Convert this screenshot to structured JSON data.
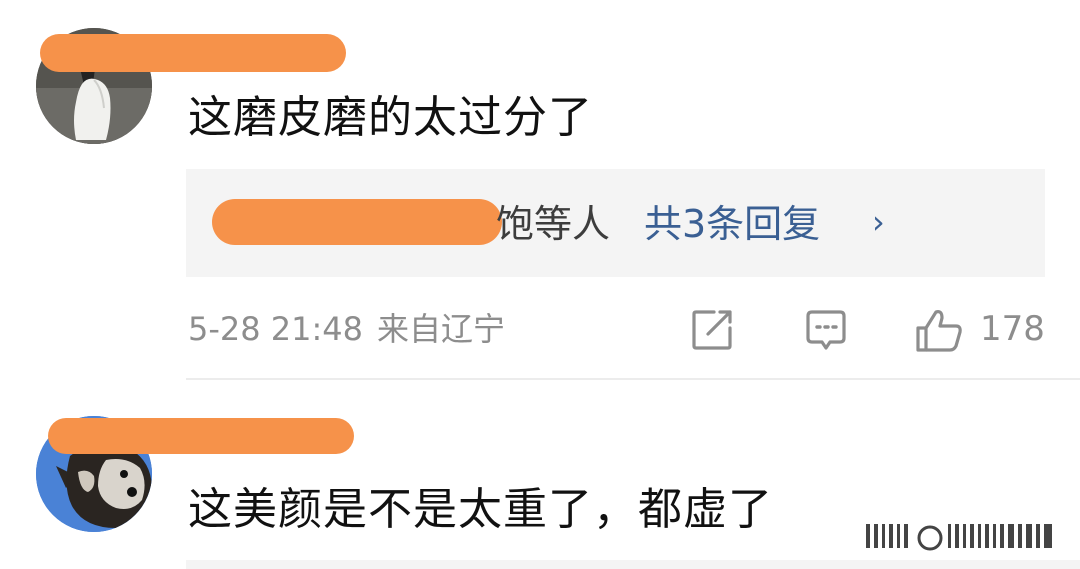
{
  "comments": [
    {
      "text": "这磨皮磨的太过分了",
      "replies": {
        "suffix": "饱等人",
        "count": "共3条回复",
        "chevron": "›"
      },
      "meta": {
        "date": "5-28 21:48",
        "location": "来自辽宁"
      },
      "actions": {
        "share_icon": "share-icon",
        "reply_icon": "comment-icon",
        "like_icon": "thumbs-up-icon",
        "like_count": "178"
      }
    },
    {
      "text": "这美颜是不是太重了，都虚了"
    }
  ],
  "redaction_color": "#f6924a",
  "link_color": "#3a5f93"
}
